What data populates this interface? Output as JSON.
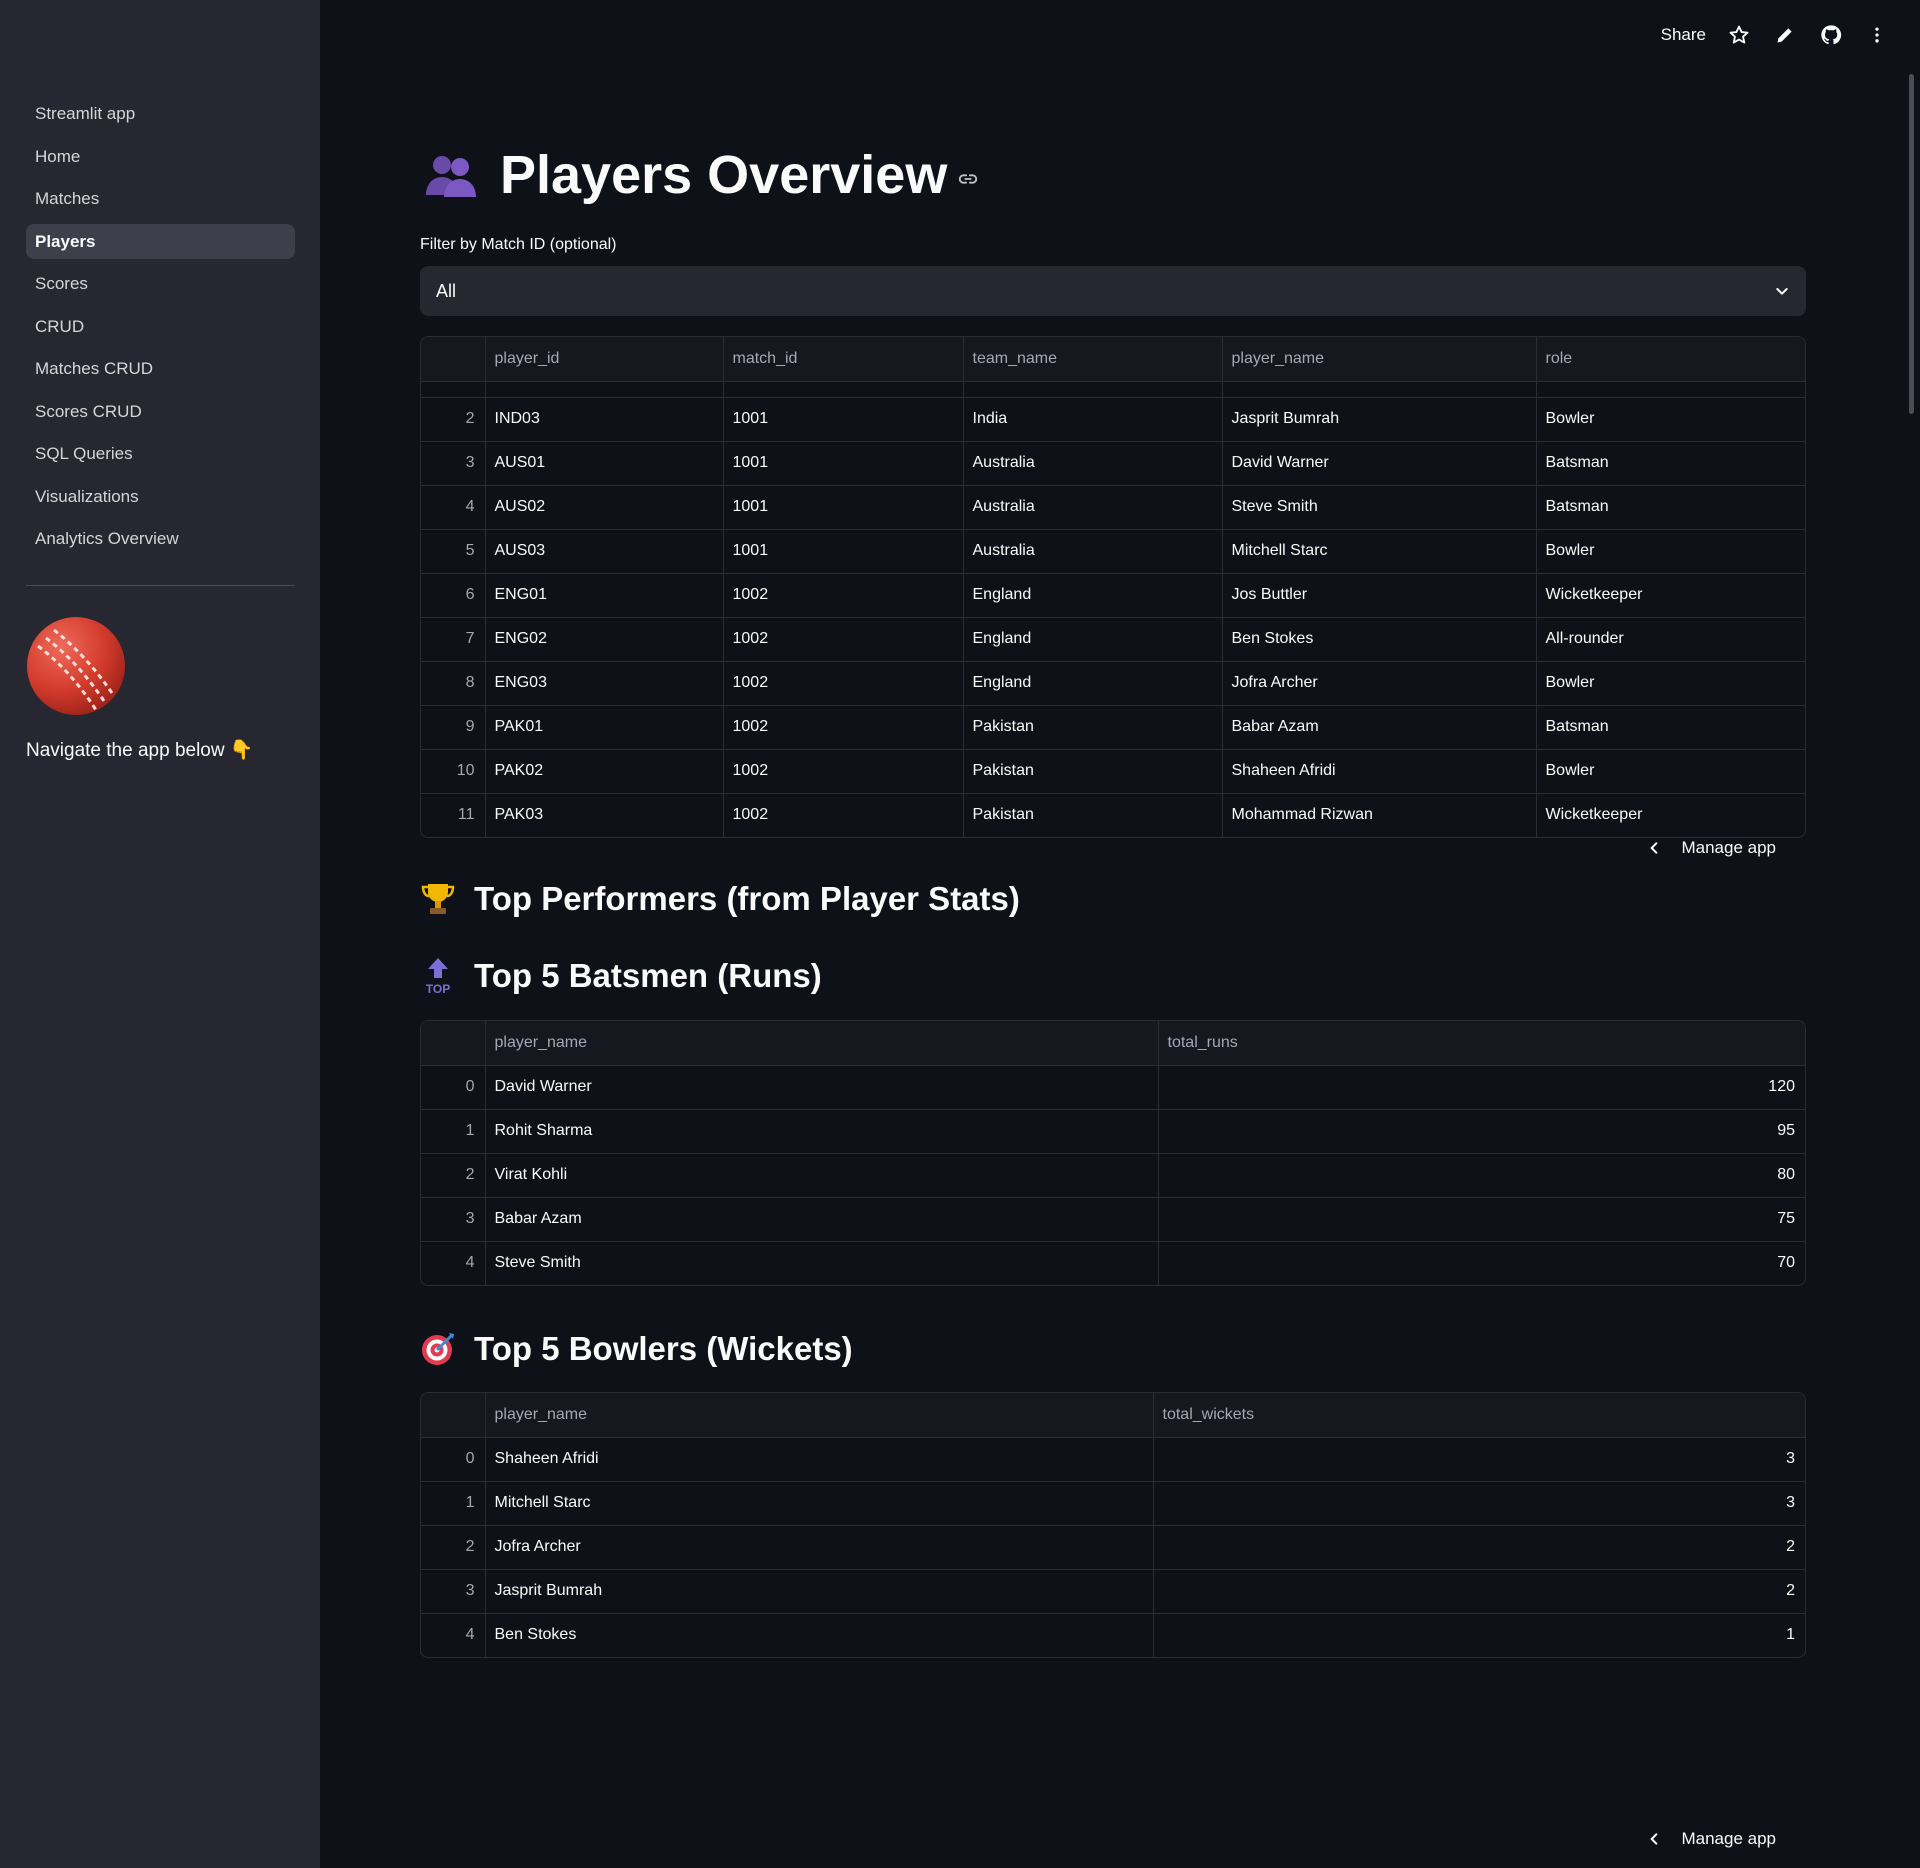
{
  "sidebar": {
    "items": [
      {
        "label": "Streamlit app",
        "active": false
      },
      {
        "label": "Home",
        "active": false
      },
      {
        "label": "Matches",
        "active": false
      },
      {
        "label": "Players",
        "active": true
      },
      {
        "label": "Scores",
        "active": false
      },
      {
        "label": "CRUD",
        "active": false
      },
      {
        "label": "Matches CRUD",
        "active": false
      },
      {
        "label": "Scores CRUD",
        "active": false
      },
      {
        "label": "SQL Queries",
        "active": false
      },
      {
        "label": "Visualizations",
        "active": false
      },
      {
        "label": "Analytics Overview",
        "active": false
      }
    ],
    "logo_icon": "cricket-ball-icon",
    "caption": "Navigate the app below 👇"
  },
  "toolbar": {
    "share_label": "Share",
    "icons": [
      "star-icon",
      "pencil-icon",
      "github-icon",
      "more-vertical-icon"
    ]
  },
  "page": {
    "title": "Players Overview",
    "title_icon": "people-icon",
    "filter_label": "Filter by Match ID (optional)",
    "filter_value": "All"
  },
  "players_table": {
    "columns": [
      "",
      "player_id",
      "match_id",
      "team_name",
      "player_name",
      "role"
    ],
    "rows": [
      [
        "2",
        "IND03",
        "1001",
        "India",
        "Jasprit Bumrah",
        "Bowler"
      ],
      [
        "3",
        "AUS01",
        "1001",
        "Australia",
        "David Warner",
        "Batsman"
      ],
      [
        "4",
        "AUS02",
        "1001",
        "Australia",
        "Steve Smith",
        "Batsman"
      ],
      [
        "5",
        "AUS03",
        "1001",
        "Australia",
        "Mitchell Starc",
        "Bowler"
      ],
      [
        "6",
        "ENG01",
        "1002",
        "England",
        "Jos Buttler",
        "Wicketkeeper"
      ],
      [
        "7",
        "ENG02",
        "1002",
        "England",
        "Ben Stokes",
        "All-rounder"
      ],
      [
        "8",
        "ENG03",
        "1002",
        "England",
        "Jofra Archer",
        "Bowler"
      ],
      [
        "9",
        "PAK01",
        "1002",
        "Pakistan",
        "Babar Azam",
        "Batsman"
      ],
      [
        "10",
        "PAK02",
        "1002",
        "Pakistan",
        "Shaheen Afridi",
        "Bowler"
      ],
      [
        "11",
        "PAK03",
        "1002",
        "Pakistan",
        "Mohammad Rizwan",
        "Wicketkeeper"
      ]
    ]
  },
  "top_performers": {
    "heading": "Top Performers (from Player Stats)",
    "heading_icon": "trophy-icon",
    "batsmen": {
      "heading": "Top 5 Batsmen (Runs)",
      "heading_icon": "top-arrow-icon",
      "columns": [
        "",
        "player_name",
        "total_runs"
      ],
      "rows": [
        [
          "0",
          "David Warner",
          "120"
        ],
        [
          "1",
          "Rohit Sharma",
          "95"
        ],
        [
          "2",
          "Virat Kohli",
          "80"
        ],
        [
          "3",
          "Babar Azam",
          "75"
        ],
        [
          "4",
          "Steve Smith",
          "70"
        ]
      ]
    },
    "bowlers": {
      "heading": "Top 5 Bowlers (Wickets)",
      "heading_icon": "target-icon",
      "columns": [
        "",
        "player_name",
        "total_wickets"
      ],
      "rows": [
        [
          "0",
          "Shaheen Afridi",
          "3"
        ],
        [
          "1",
          "Mitchell Starc",
          "3"
        ],
        [
          "2",
          "Jofra Archer",
          "2"
        ],
        [
          "3",
          "Jasprit Bumrah",
          "2"
        ],
        [
          "4",
          "Ben Stokes",
          "1"
        ]
      ]
    }
  },
  "manage_app_label": "Manage app"
}
